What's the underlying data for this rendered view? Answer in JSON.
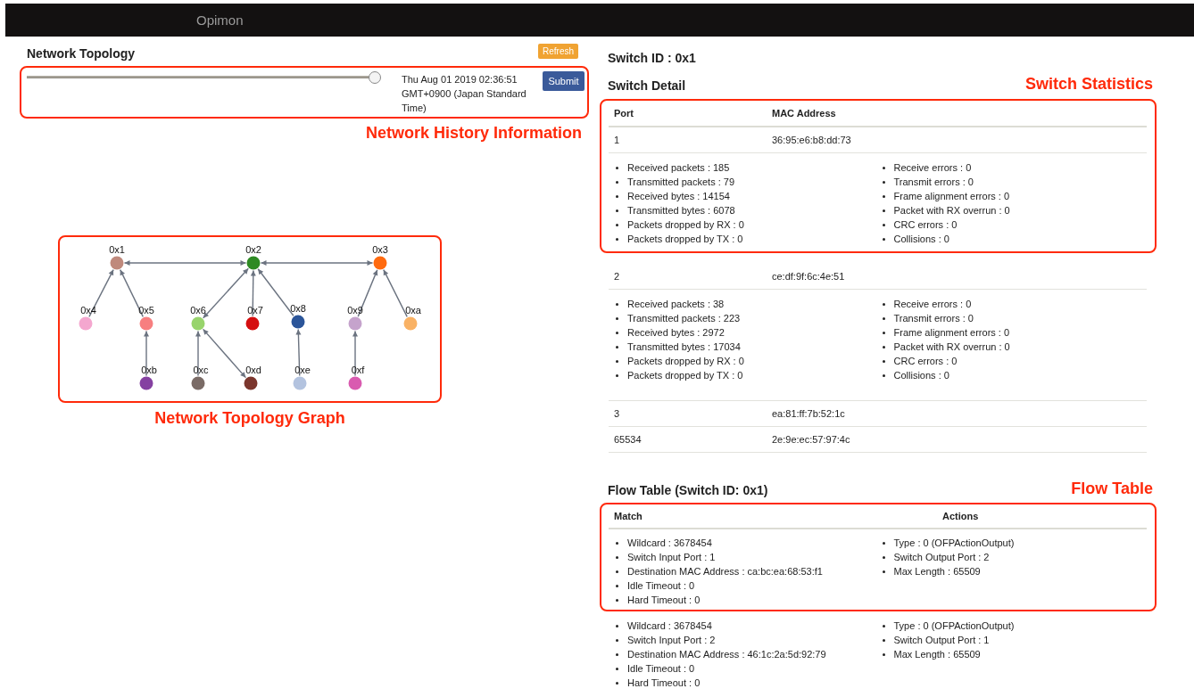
{
  "navbar": {
    "brand": "Opimon"
  },
  "topology": {
    "title": "Network Topology",
    "refresh_button": "Refresh",
    "slider": {
      "level": 1
    },
    "timestamp": "Thu Aug 01 2019 02:36:51 GMT+0900 (Japan Standard Time)",
    "submit_button": "Submit",
    "annotation": "Network History Information",
    "graph": {
      "annotation": "Network Topology Graph",
      "nodes": [
        {
          "label": "0x1",
          "color": "#bf897c",
          "peer_link": true,
          "children": [
            {
              "label": "0x4",
              "color": "#f4a7cf",
              "bidirectional": false
            },
            {
              "label": "0x5",
              "color": "#f77f80",
              "bidirectional": false,
              "children": [
                {
                  "label": "0xb",
                  "color": "#8541a1",
                  "bidirectional": false
                }
              ]
            }
          ]
        },
        {
          "label": "0x2",
          "color": "#2e8a23",
          "peer_link": true,
          "children": [
            {
              "label": "0x6",
              "color": "#98d46c",
              "bidirectional": true,
              "children": [
                {
                  "label": "0xc",
                  "color": "#7a6b66",
                  "bidirectional": false
                },
                {
                  "label": "0xd",
                  "color": "#7b362d",
                  "bidirectional": true
                }
              ]
            },
            {
              "label": "0x7",
              "color": "#d50f10",
              "bidirectional": false
            },
            {
              "label": "0x8",
              "color": "#2b5599",
              "bidirectional": false,
              "children": [
                {
                  "label": "0xe",
                  "color": "#b3c3df",
                  "bidirectional": false
                }
              ]
            }
          ]
        },
        {
          "label": "0x3",
          "color": "#ff6a0f",
          "peer_link": false,
          "children": [
            {
              "label": "0x9",
              "color": "#c5a3cc",
              "bidirectional": false,
              "children": [
                {
                  "label": "0xf",
                  "color": "#d95bb0",
                  "bidirectional": false
                }
              ]
            },
            {
              "label": "0xa",
              "color": "#f9b265",
              "bidirectional": false
            }
          ]
        }
      ]
    }
  },
  "switch": {
    "heading": "Switch ID : 0x1",
    "detail_title": "Switch Detail",
    "annotation": "Switch Statistics",
    "columns": [
      "Port",
      "MAC Address"
    ],
    "annotated_ports": [
      {
        "port": "1",
        "mac": "36:95:e6:b8:dd:73",
        "stats_left": [
          "Received packets : 185",
          "Transmitted packets : 79",
          "Received bytes : 14154",
          "Transmitted bytes : 6078",
          "Packets dropped by RX : 0",
          "Packets dropped by TX : 0"
        ],
        "stats_right": [
          "Receive errors : 0",
          "Transmit errors : 0",
          "Frame alignment errors : 0",
          "Packet with RX overrun : 0",
          "CRC errors : 0",
          "Collisions : 0"
        ]
      }
    ],
    "other_ports": [
      {
        "port": "2",
        "mac": "ce:df:9f:6c:4e:51",
        "stats_left": [
          "Received packets : 38",
          "Transmitted packets : 223",
          "Received bytes : 2972",
          "Transmitted bytes : 17034",
          "Packets dropped by RX : 0",
          "Packets dropped by TX : 0"
        ],
        "stats_right": [
          "Receive errors : 0",
          "Transmit errors : 0",
          "Frame alignment errors : 0",
          "Packet with RX overrun : 0",
          "CRC errors : 0",
          "Collisions : 0"
        ]
      },
      {
        "port": "3",
        "mac": "ea:81:ff:7b:52:1c"
      },
      {
        "port": "65534",
        "mac": "2e:9e:ec:57:97:4c"
      }
    ]
  },
  "flow_table": {
    "title": "Flow Table (Switch ID: 0x1)",
    "annotation": "Flow Table",
    "columns": [
      "Match",
      "Actions"
    ],
    "annotated_flows": [
      {
        "match": [
          "Wildcard : 3678454",
          "Switch Input Port : 1",
          "Destination MAC Address : ca:bc:ea:68:53:f1",
          "Idle Timeout : 0",
          "Hard Timeout : 0"
        ],
        "actions": [
          "Type : 0 (OFPActionOutput)",
          "Switch Output Port : 2",
          "Max Length : 65509"
        ]
      }
    ],
    "other_flows": [
      {
        "match": [
          "Wildcard : 3678454",
          "Switch Input Port : 2",
          "Destination MAC Address : 46:1c:2a:5d:92:79",
          "Idle Timeout : 0",
          "Hard Timeout : 0"
        ],
        "actions": [
          "Type : 0 (OFPActionOutput)",
          "Switch Output Port : 1",
          "Max Length : 65509"
        ]
      }
    ]
  }
}
